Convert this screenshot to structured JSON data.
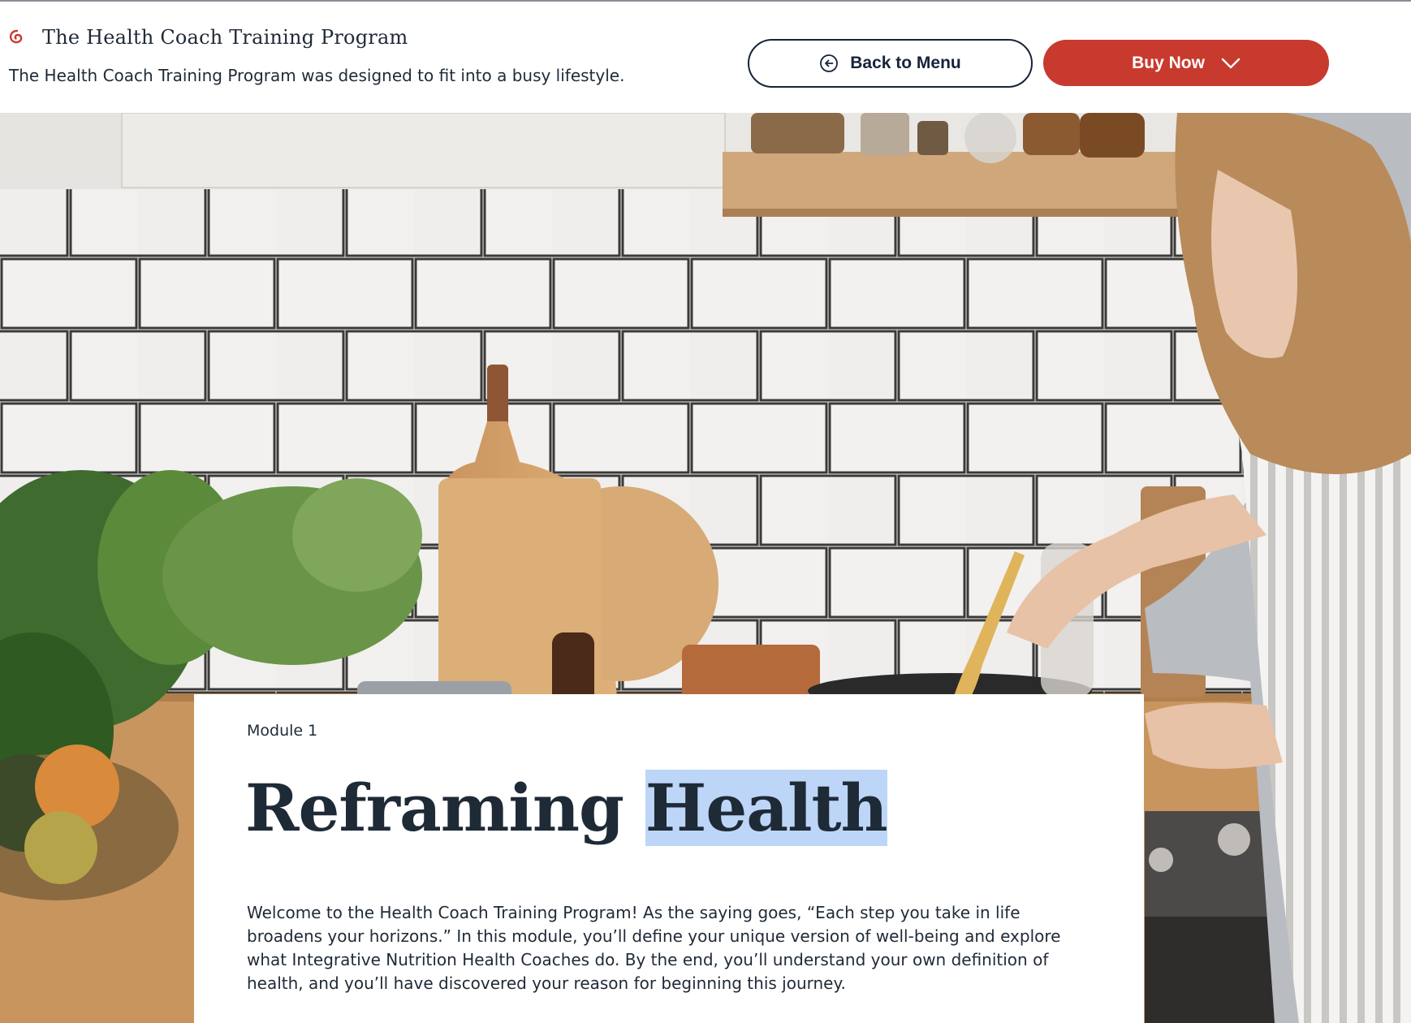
{
  "header": {
    "brand_title": "The Health Coach Training Program",
    "subtitle": "The Health Coach Training Program was designed to fit into a busy lifestyle.",
    "back_button_label": "Back to Menu",
    "buy_button_label": "Buy Now",
    "logo_icon": "swirl-logo-icon",
    "back_icon": "arrow-left-circle-icon",
    "buy_icon": "chevron-down-icon"
  },
  "hero": {
    "image_subject": "woman cooking in kitchen with white subway tiles, cutting boards and greens"
  },
  "module": {
    "label": "Module 1",
    "title_part1": "Reframing ",
    "title_part2": "Health",
    "description": "Welcome to the Health Coach Training Program! As the saying goes, “Each step you take in life broadens your horizons.” In this module, you’ll define your unique version of well-being and explore what Integrative Nutrition Health Coaches do. By the end, you’ll understand your own definition of health, and you’ll have discovered your reason for beginning this journey."
  },
  "colors": {
    "accent_red": "#c83a2e",
    "navy": "#16233a",
    "text": "#1f2a37",
    "selection": "#bdd6f7"
  }
}
